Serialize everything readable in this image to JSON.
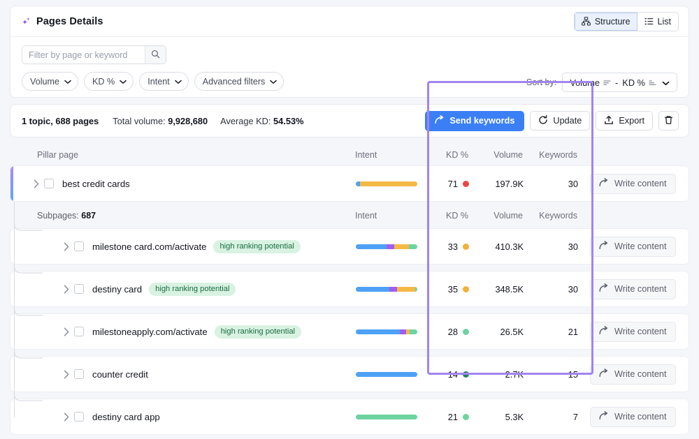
{
  "header": {
    "title": "Pages Details",
    "sparkle_icon": "sparkle-icon",
    "views": [
      {
        "label": "Structure",
        "icon": "structure-icon",
        "active": true
      },
      {
        "label": "List",
        "icon": "list-icon",
        "active": false
      }
    ]
  },
  "filters": {
    "search": {
      "placeholder": "Filter by page or keyword",
      "value": "",
      "icon": "search-icon"
    },
    "chips": [
      {
        "label": "Volume"
      },
      {
        "label": "KD %"
      },
      {
        "label": "Intent"
      },
      {
        "label": "Advanced filters"
      }
    ],
    "sort": {
      "label": "Sort by:",
      "primary": "Volume",
      "separator": "-",
      "secondary": "KD %"
    }
  },
  "stats": {
    "topics_pages": "1 topic, 688 pages",
    "total_volume_label": "Total volume:",
    "total_volume_value": "9,928,680",
    "average_kd_label": "Average KD:",
    "average_kd_value": "54.53%",
    "actions": [
      {
        "label": "Send keywords",
        "icon": "arrow-forward-icon",
        "style": "primary"
      },
      {
        "label": "Update",
        "icon": "refresh-icon",
        "style": "default"
      },
      {
        "label": "Export",
        "icon": "upload-icon",
        "style": "default"
      },
      {
        "label": "",
        "icon": "trash-icon",
        "style": "icon-only"
      }
    ]
  },
  "table": {
    "pillar_columns": {
      "page": "Pillar page",
      "intent": "Intent",
      "kd": "KD %",
      "volume": "Volume",
      "keywords": "Keywords"
    },
    "subpages_columns": {
      "page_prefix": "Subpages:",
      "page_count": "687",
      "intent": "Intent",
      "kd": "KD %",
      "volume": "Volume",
      "keywords": "Keywords"
    },
    "write_label": "Write content",
    "pillar": {
      "name": "best credit cards",
      "badge": "",
      "intent_segments": [
        {
          "color": "#4da2f5",
          "pct": 7
        },
        {
          "color": "#f5b946",
          "pct": 93
        }
      ],
      "kd": "71",
      "kd_color": "#ef4444",
      "volume": "197.9K",
      "keywords": "30"
    },
    "subpages": [
      {
        "name": "milestone card.com/activate",
        "badge": "high ranking potential",
        "intent_segments": [
          {
            "color": "#4da2f5",
            "pct": 50
          },
          {
            "color": "#a05df0",
            "pct": 13
          },
          {
            "color": "#f5b946",
            "pct": 23
          },
          {
            "color": "#6dd3a0",
            "pct": 14
          }
        ],
        "kd": "33",
        "kd_color": "#f2b138",
        "volume": "410.3K",
        "keywords": "30"
      },
      {
        "name": "destiny card",
        "badge": "high ranking potential",
        "intent_segments": [
          {
            "color": "#4da2f5",
            "pct": 54
          },
          {
            "color": "#a05df0",
            "pct": 13
          },
          {
            "color": "#f5b946",
            "pct": 30
          },
          {
            "color": "#6dd3a0",
            "pct": 3
          }
        ],
        "kd": "35",
        "kd_color": "#f2b138",
        "volume": "348.5K",
        "keywords": "30"
      },
      {
        "name": "milestoneapply.com/activate",
        "badge": "high ranking potential",
        "intent_segments": [
          {
            "color": "#4da2f5",
            "pct": 72
          },
          {
            "color": "#a05df0",
            "pct": 10
          },
          {
            "color": "#f5b946",
            "pct": 5
          },
          {
            "color": "#6dd3a0",
            "pct": 13
          }
        ],
        "kd": "28",
        "kd_color": "#6dd3a0",
        "volume": "26.5K",
        "keywords": "21"
      },
      {
        "name": "counter credit",
        "badge": "",
        "intent_segments": [
          {
            "color": "#4da2f5",
            "pct": 100
          }
        ],
        "kd": "14",
        "kd_color": "#21855c",
        "volume": "2.7K",
        "keywords": "15"
      },
      {
        "name": "destiny card app",
        "badge": "",
        "intent_segments": [
          {
            "color": "#6dd3a0",
            "pct": 100
          }
        ],
        "kd": "21",
        "kd_color": "#6dd3a0",
        "volume": "5.3K",
        "keywords": "7"
      }
    ]
  },
  "annotation": {
    "highlight_color": "#a284f0"
  }
}
